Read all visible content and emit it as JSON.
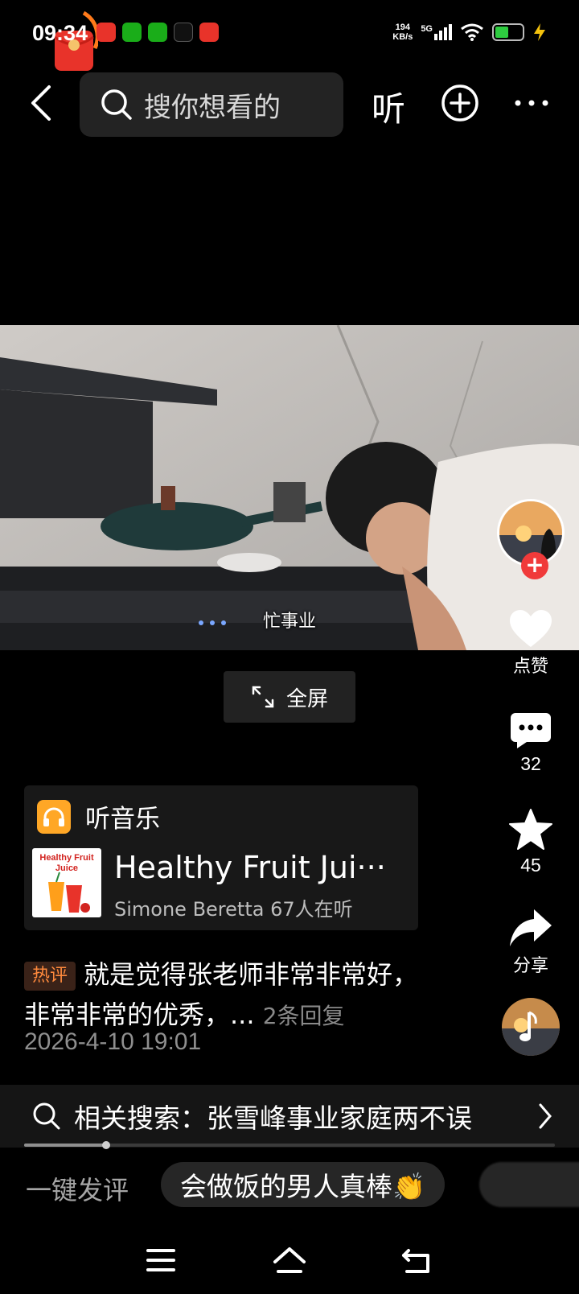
{
  "status_bar": {
    "time": "09:34",
    "net_speed_value": "194",
    "net_speed_unit": "KB/s",
    "network": "5G",
    "notification_icons": [
      "toutiao-icon",
      "wechat-icon",
      "wechat-moments-icon",
      "tiktok-icon",
      "toutiao-icon"
    ]
  },
  "top_nav": {
    "search_placeholder": "搜你想看的",
    "listen_label": "听"
  },
  "video": {
    "subtitle": "忙事业"
  },
  "fullscreen": {
    "label": "全屏"
  },
  "actions": {
    "like_label": "点赞",
    "comment_count": "32",
    "favorite_count": "45",
    "share_label": "分享"
  },
  "music_card": {
    "header": "听音乐",
    "cover_text": "Healthy Fruit Juice",
    "song_title": "Healthy Fruit Jui···",
    "song_meta": "Simone Beretta 67人在听"
  },
  "hot_comment": {
    "tag": "热评",
    "text": "就是觉得张老师非常非常好，非常非常的优秀，...",
    "replies": "2条回复",
    "time": "2026-4-10 19:01"
  },
  "related_search": {
    "text": "相关搜索：张雪峰事业家庭两不误"
  },
  "progress": {
    "fraction": 0.155
  },
  "quick_comment": {
    "label": "一键发评",
    "chips": [
      "会做饭的男人真棒👏"
    ]
  },
  "colors": {
    "background": "#000000",
    "accent_red": "#f03a3a",
    "hot_tag": "#ff8a3d",
    "music_icon": "#ffa726"
  }
}
